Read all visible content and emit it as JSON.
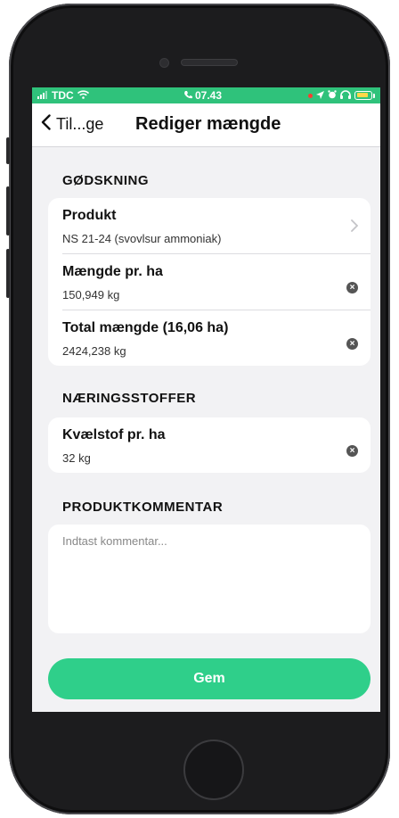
{
  "status_bar": {
    "carrier": "TDC",
    "time": "07.43"
  },
  "nav": {
    "back_label": "Til...ge",
    "title": "Rediger mængde"
  },
  "sections": {
    "fertilizing": {
      "header": "GØDSKNING",
      "rows": [
        {
          "title": "Produkt",
          "value": "NS 21-24 (svovlsur ammoniak)"
        },
        {
          "title": "Mængde pr. ha",
          "value": "150,949 kg"
        },
        {
          "title": "Total mængde (16,06 ha)",
          "value": "2424,238 kg"
        }
      ]
    },
    "nutrients": {
      "header": "NÆRINGSSTOFFER",
      "rows": [
        {
          "title": "Kvælstof pr. ha",
          "value": "32 kg"
        }
      ]
    },
    "comment": {
      "header": "PRODUKTKOMMENTAR",
      "placeholder": "Indtast kommentar..."
    }
  },
  "save_button": "Gem",
  "colors": {
    "accent": "#2fcf8a",
    "status_bar": "#2fc27b"
  }
}
